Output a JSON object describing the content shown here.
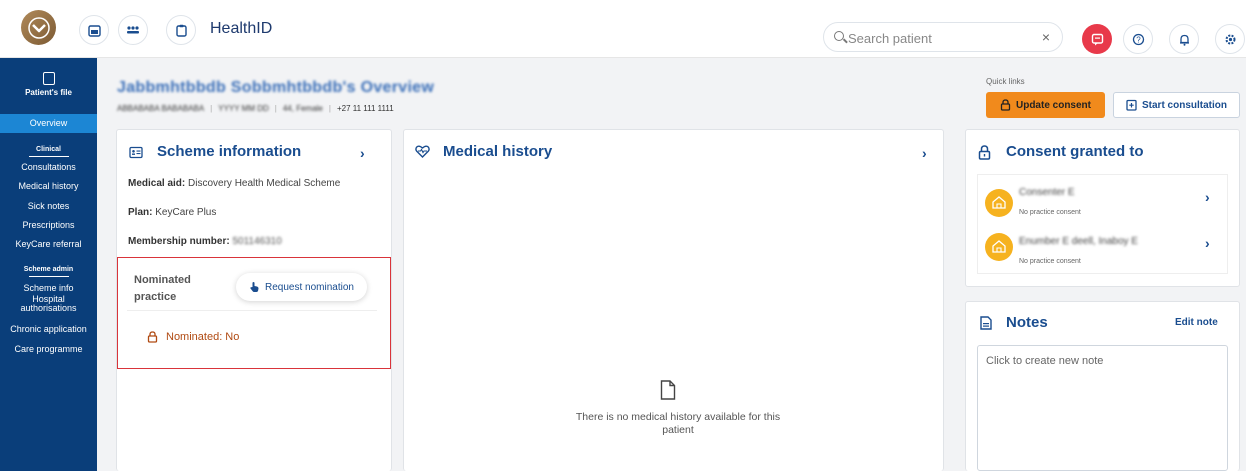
{
  "topbar": {
    "app_title": "HealthID",
    "search_placeholder": "Search patient",
    "clear_icon": "×"
  },
  "sidebar": {
    "patient_file": "Patient's file",
    "overview": "Overview",
    "clinical_section": "Clinical",
    "clinical_items": [
      "Consultations",
      "Medical history",
      "Sick notes",
      "Prescriptions",
      "KeyCare referral"
    ],
    "scheme_section": "Scheme admin",
    "scheme_items": [
      "Scheme info",
      "Hospital authorisations",
      "Chronic application",
      "Care programme"
    ]
  },
  "header": {
    "patient_name": "Jabbmhtbbdb Sobbmhtbbdb's Overview",
    "meta_id": "ABBABABA BABABABA",
    "meta_dob": "YYYY MM DD",
    "meta_age": "44, Female",
    "meta_phone": "+27 11 111 1111",
    "quick_links": "Quick links",
    "update_consent": "Update consent",
    "start_consultation": "Start consultation"
  },
  "scheme": {
    "title": "Scheme information",
    "medical_aid_label": "Medical aid:",
    "medical_aid_value": "Discovery Health Medical Scheme",
    "plan_label": "Plan:",
    "plan_value": "KeyCare Plus",
    "membership_label": "Membership number:",
    "membership_value": "501146310",
    "nominated_practice_title_1": "Nominated",
    "nominated_practice_title_2": "practice",
    "request_nomination": "Request nomination",
    "nominated_status": "Nominated: No"
  },
  "medical_history": {
    "title": "Medical history",
    "empty_line_1": "There is no medical history available for this",
    "empty_line_2": "patient"
  },
  "consent": {
    "title": "Consent granted to",
    "items": [
      {
        "name": "Consenter E",
        "sub": "No practice consent"
      },
      {
        "name": "Enumber E deell, Inaboy E",
        "sub": "No practice consent"
      }
    ]
  },
  "notes": {
    "title": "Notes",
    "edit": "Edit note",
    "placeholder": "Click to create new note"
  },
  "colors": {
    "brand_navy": "#0a3e7a",
    "active_blue": "#1c86d4",
    "accent_orange": "#f18a1c",
    "alert_red": "#e8394a",
    "title_blue": "#1a4d8f"
  }
}
